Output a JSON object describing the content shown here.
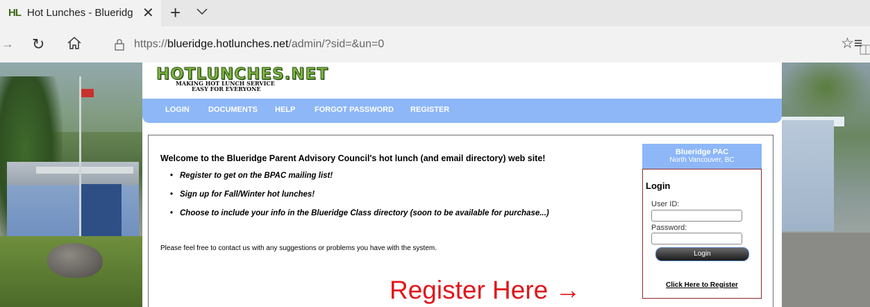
{
  "browser": {
    "tab": {
      "favicon_text": "HL",
      "title": "Hot Lunches - Blueridge",
      "close": "✕",
      "new_tab": "+"
    },
    "nav": {
      "back": "→",
      "refresh": "↻",
      "star": "☆",
      "favorites": "☆≡"
    },
    "address": {
      "scheme": "https://",
      "host": "blueridge.hotlunches.net",
      "path": "/admin/?sid=&un=0"
    }
  },
  "site": {
    "logo": {
      "main": "HOTLUNCHES.NET",
      "tagline_1": "MAKING HOT LUNCH SERVICE",
      "tagline_2": "EASY FOR EVERYONE"
    },
    "menu": [
      "LOGIN",
      "DOCUMENTS",
      "HELP",
      "FORGOT PASSWORD",
      "REGISTER"
    ],
    "welcome": "Welcome to the Blueridge Parent Advisory Council's hot lunch (and email directory) web site!",
    "bullets": [
      "Register to get on the BPAC mailing list!",
      "Sign up for Fall/Winter hot lunches!",
      "Choose to include your info in the Blueridge Class directory (soon to be available for purchase...)"
    ],
    "bullet_glyph": "•",
    "contact": "Please feel free to contact us with any suggestions or problems you have with the system.",
    "pac": {
      "name": "Blueridge PAC",
      "location": "North Vancouver, BC"
    },
    "login": {
      "title": "Login",
      "user_label": "User ID:",
      "password_label": "Password:",
      "button": "Login",
      "register_link": "Click Here to Register"
    }
  },
  "annotation": {
    "text": "Register Here →",
    "color": "#e0161b"
  },
  "colors": {
    "menu_bg": "#8db7f7",
    "login_border": "#8b2a2a",
    "logo_green": "#7cb342"
  }
}
